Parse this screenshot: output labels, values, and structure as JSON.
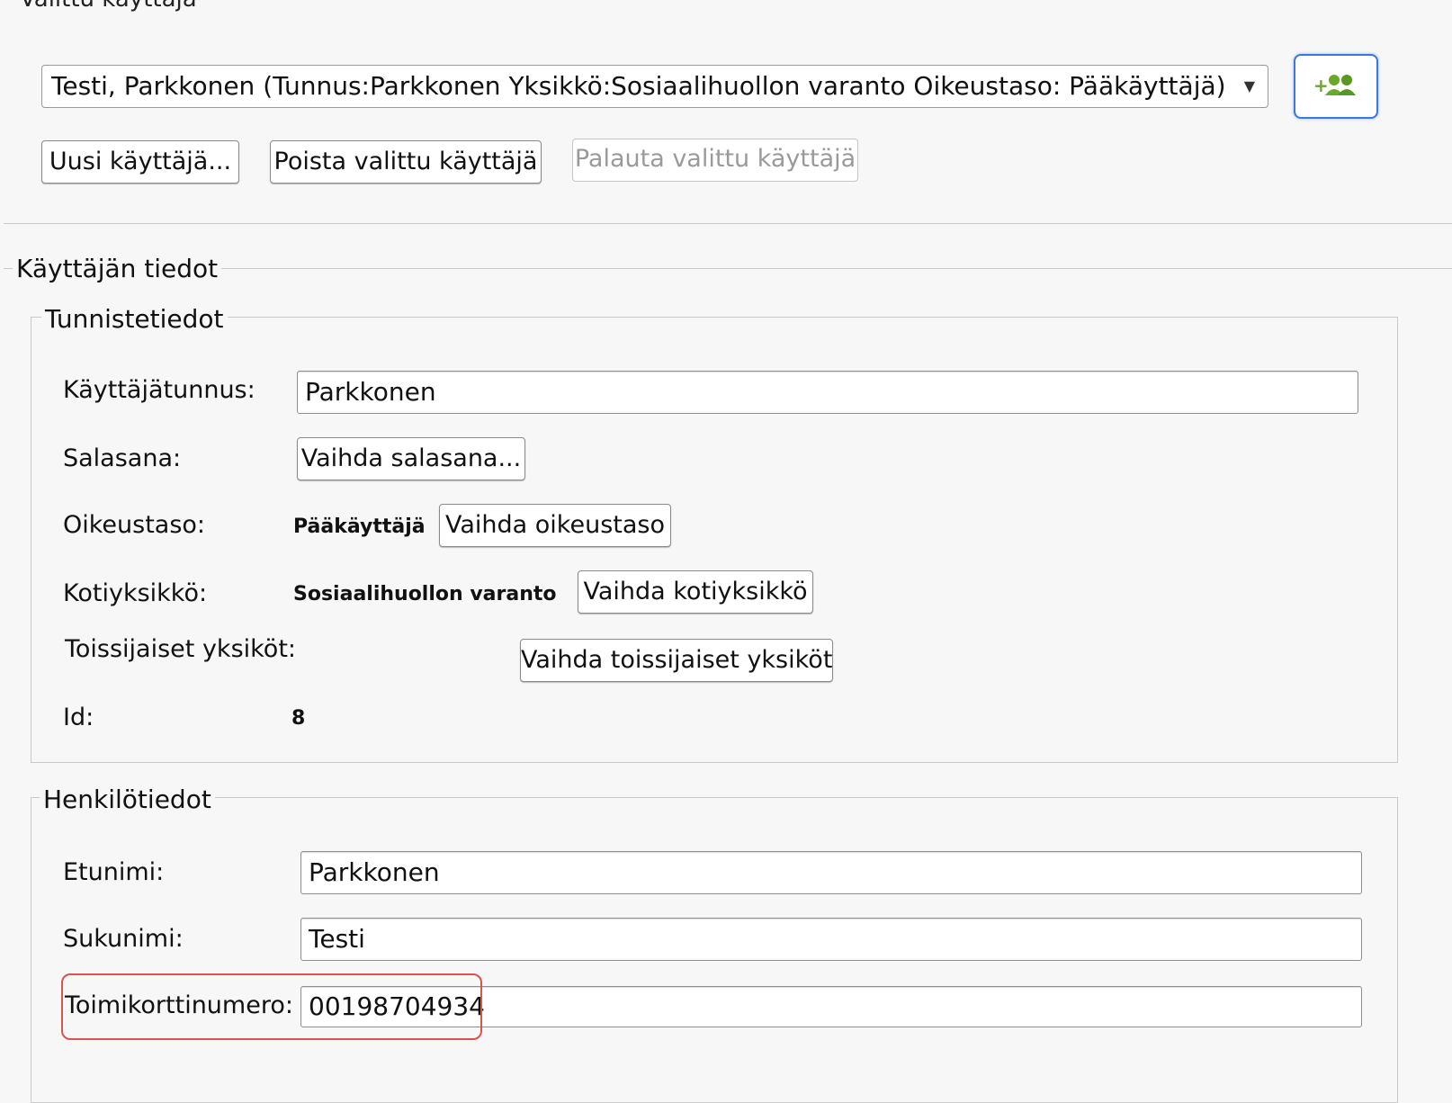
{
  "header": {
    "selected_user_label": "Valittu käyttäjä"
  },
  "user_select": {
    "value": "Testi, Parkkonen (Tunnus:Parkkonen Yksikkö:Sosiaalihuollon varanto Oikeustaso: Pääkäyttäjä)"
  },
  "actions": {
    "new_user": "Uusi käyttäjä...",
    "delete_user": "Poista valittu käyttäjä",
    "restore_user": "Palauta valittu käyttäjä"
  },
  "user_info": {
    "legend": "Käyttäjän tiedot",
    "identity": {
      "legend": "Tunnistetiedot",
      "username_label": "Käyttäjätunnus:",
      "username_value": "Parkkonen",
      "password_label": "Salasana:",
      "password_button": "Vaihda salasana...",
      "access_label": "Oikeustaso:",
      "access_value": "Pääkäyttäjä",
      "access_button": "Vaihda oikeustaso",
      "home_unit_label": "Kotiyksikkö:",
      "home_unit_value": "Sosiaalihuollon varanto",
      "home_unit_button": "Vaihda kotiyksikkö",
      "secondary_units_label": "Toissijaiset yksiköt:",
      "secondary_units_button": "Vaihda toissijaiset yksiköt",
      "id_label": "Id:",
      "id_value": "8"
    },
    "personal": {
      "legend": "Henkilötiedot",
      "first_name_label": "Etunimi:",
      "first_name_value": "Parkkonen",
      "last_name_label": "Sukunimi:",
      "last_name_value": "Testi",
      "card_number_label": "Toimikorttinumero:",
      "card_number_value": "00198704934"
    }
  },
  "colors": {
    "accent": "#3b7ad8",
    "icon_green": "#6aa82a",
    "highlight": "#d9534f"
  },
  "icons": {
    "add_user": "add-users-icon"
  }
}
